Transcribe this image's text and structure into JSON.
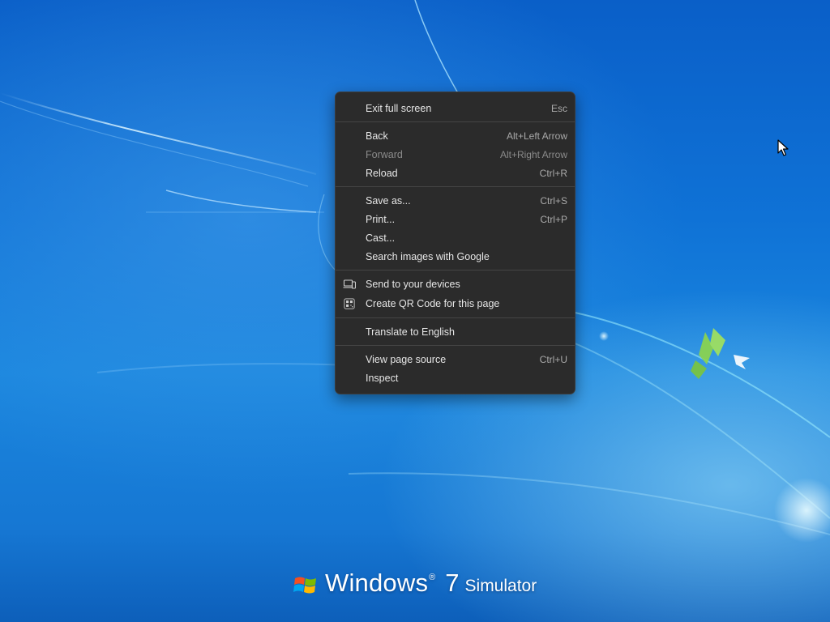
{
  "menu": {
    "groups": [
      [
        {
          "label": "Exit full screen",
          "shortcut": "Esc"
        }
      ],
      [
        {
          "label": "Back",
          "shortcut": "Alt+Left Arrow"
        },
        {
          "label": "Forward",
          "shortcut": "Alt+Right Arrow",
          "disabled": true
        },
        {
          "label": "Reload",
          "shortcut": "Ctrl+R"
        }
      ],
      [
        {
          "label": "Save as...",
          "shortcut": "Ctrl+S"
        },
        {
          "label": "Print...",
          "shortcut": "Ctrl+P"
        },
        {
          "label": "Cast..."
        },
        {
          "label": "Search images with Google"
        }
      ],
      [
        {
          "label": "Send to your devices",
          "icon": "devices-icon"
        },
        {
          "label": "Create QR Code for this page",
          "icon": "qr-code-icon"
        }
      ],
      [
        {
          "label": "Translate to English"
        }
      ],
      [
        {
          "label": "View page source",
          "shortcut": "Ctrl+U"
        },
        {
          "label": "Inspect"
        }
      ]
    ]
  },
  "branding": {
    "name": "Windows",
    "registered": "®",
    "version": "7",
    "suffix": "Simulator"
  },
  "colors": {
    "menu_background": "#2b2b2b",
    "menu_text": "#e6e6e6",
    "shortcut_text": "#a9a9a9",
    "disabled_text": "#8a8a8a",
    "desktop_blue": "#0f72d6"
  },
  "icons": {
    "cursor": "mouse-pointer-icon",
    "logo": "windows-flag-icon"
  }
}
